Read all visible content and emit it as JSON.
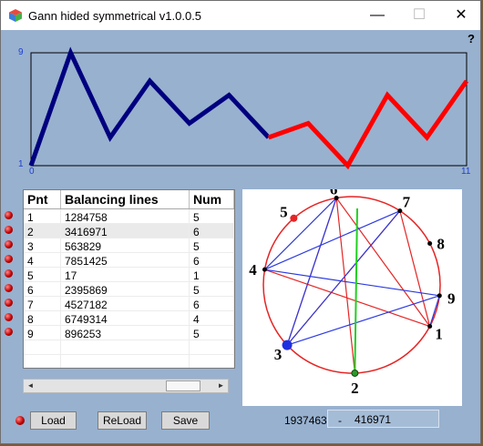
{
  "window": {
    "title": "Gann hided symmetrical v1.0.0.5",
    "minimize": "—",
    "maximize": "☐",
    "close": "✕",
    "help": "?"
  },
  "colors": {
    "background": "#98b1cf",
    "line_blue": "#00007f",
    "line_red": "#ff0000",
    "circle": "#e52525",
    "chord_blue": "#2b3ae0",
    "chord_red": "#e52525",
    "axis_green": "#20d020"
  },
  "chart_data": {
    "type": "line",
    "xlim": [
      0,
      11
    ],
    "ylim": [
      1,
      9
    ],
    "x_ticks": [
      "0",
      "11"
    ],
    "y_ticks": [
      "1",
      "9"
    ],
    "series": [
      {
        "color": "#00007f",
        "x": [
          0,
          1,
          2,
          3,
          4,
          5,
          6
        ],
        "y": [
          1,
          9,
          3,
          7,
          4,
          6,
          3
        ]
      },
      {
        "color": "#ff0000",
        "x": [
          6,
          7,
          8,
          9,
          10,
          11
        ],
        "y": [
          3,
          4,
          1,
          6,
          3,
          7
        ]
      }
    ]
  },
  "table": {
    "headers": [
      "Pnt",
      "Balancing lines",
      "Num"
    ],
    "rows": [
      [
        "1",
        "1284758",
        "5"
      ],
      [
        "2",
        "3416971",
        "6"
      ],
      [
        "3",
        "563829",
        "5"
      ],
      [
        "4",
        "7851425",
        "6"
      ],
      [
        "5",
        "17",
        "1"
      ],
      [
        "6",
        "2395869",
        "5"
      ],
      [
        "7",
        "4527182",
        "6"
      ],
      [
        "8",
        "6749314",
        "4"
      ],
      [
        "9",
        "896253",
        "5"
      ]
    ],
    "selected_row": 2
  },
  "scrollbar": {
    "left": "◄",
    "right": "►"
  },
  "circle": {
    "labels": [
      "1",
      "2",
      "3",
      "4",
      "5",
      "6",
      "7",
      "8",
      "9"
    ]
  },
  "buttons": {
    "load": "Load",
    "reload": "ReLoad",
    "save": "Save"
  },
  "status": {
    "left_number": "1937463",
    "separator": "-",
    "field_value": "416971"
  }
}
